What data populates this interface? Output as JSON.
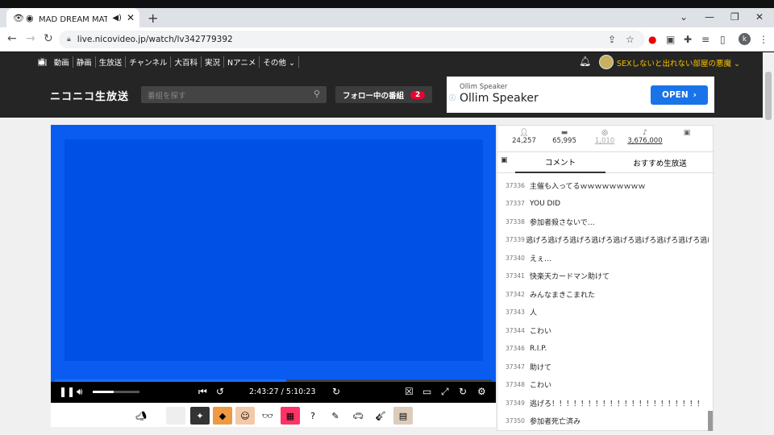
{
  "browser": {
    "tab_title": "MAD DREAM MATCH -天",
    "tab_favicon": "👁",
    "url": "live.nicovideo.jp/watch/lv342779392",
    "profile_initial": "k"
  },
  "nico_nav": {
    "items": [
      "動画",
      "静画",
      "生放送",
      "チャンネル",
      "大百科",
      "実況",
      "Nアニメ",
      "その他 ⌄"
    ],
    "username": "SEXしないと出れない部屋の悪魔 ⌄"
  },
  "header": {
    "logo": "ニコニコ生放送",
    "search_placeholder": "番組を探す",
    "follow_label": "フォロー中の番組",
    "follow_count": "2"
  },
  "ad": {
    "small": "Ollim Speaker",
    "big": "Ollim Speaker",
    "open_label": "OPEN",
    "open_arrow": "›"
  },
  "player": {
    "time": "2:43:27 / 5:10:23",
    "progress_fraction": 0.53,
    "volume_fraction": 0.45
  },
  "stats": {
    "viewers": "24,257",
    "comments": "65,995",
    "ads": "1,010",
    "gifts": "3,676,000"
  },
  "side_tabs": {
    "comment": "コメント",
    "recommend": "おすすめ生放送"
  },
  "comments": [
    {
      "no": "37336",
      "text": "主催も入ってるｗｗｗｗｗｗｗｗｗ"
    },
    {
      "no": "37337",
      "text": "YOU DID"
    },
    {
      "no": "37338",
      "text": "参加者殺さないで…"
    },
    {
      "no": "37339",
      "text": "逃げろ逃げろ逃げろ逃げろ逃げろ逃げろ逃げろ逃げろ逃げろ逃げろ"
    },
    {
      "no": "37340",
      "text": "えぇ…"
    },
    {
      "no": "37341",
      "text": "快楽天カードマン助けて"
    },
    {
      "no": "37342",
      "text": "みんなまきこまれた"
    },
    {
      "no": "37343",
      "text": "人"
    },
    {
      "no": "37344",
      "text": "こわい"
    },
    {
      "no": "37346",
      "text": "R.I.P."
    },
    {
      "no": "37347",
      "text": "助けて"
    },
    {
      "no": "37348",
      "text": "こわい"
    },
    {
      "no": "37349",
      "text": "逃げろ！！！！！！！！！！！！！！！！！！！！！"
    },
    {
      "no": "37350",
      "text": "参加者死亡済み"
    }
  ]
}
